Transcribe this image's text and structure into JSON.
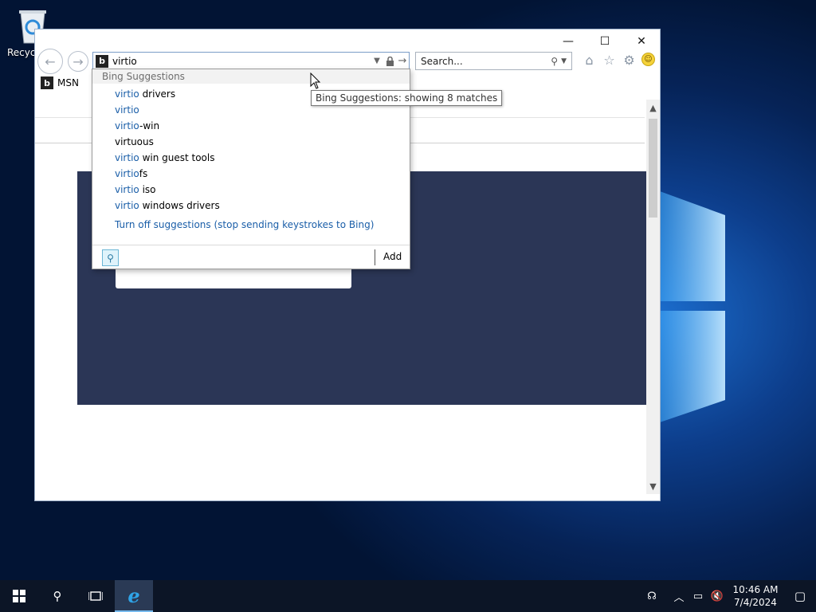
{
  "desktop": {
    "recycle_bin_label": "Recycle"
  },
  "browser": {
    "title_buttons": {
      "minimize": "—",
      "maximize": "☐",
      "close": "✕"
    },
    "address": {
      "value": "virtio"
    },
    "search": {
      "placeholder": "Search..."
    },
    "tab": {
      "label": "MSN"
    }
  },
  "suggestions": {
    "header": "Bing Suggestions",
    "items": [
      {
        "match": "virtio",
        "rest": " drivers"
      },
      {
        "match": "virtio",
        "rest": ""
      },
      {
        "match": "virtio",
        "rest": "-win"
      },
      {
        "match": "",
        "rest": "virtuous"
      },
      {
        "match": "virtio",
        "rest": " win guest tools"
      },
      {
        "match": "virtio",
        "rest": "fs"
      },
      {
        "match": "virtio",
        "rest": " iso"
      },
      {
        "match": "virtio",
        "rest": " windows drivers"
      }
    ],
    "turn_off": "Turn off suggestions (stop sending keystrokes to Bing)",
    "add_label": "Add"
  },
  "tooltip": "Bing Suggestions: showing 8 matches",
  "taskbar": {
    "clock_time": "10:46 AM",
    "clock_date": "7/4/2024"
  },
  "colors": {
    "link": "#1a5ea8",
    "hero": "#2b3656",
    "taskbar": "#0c1526"
  }
}
